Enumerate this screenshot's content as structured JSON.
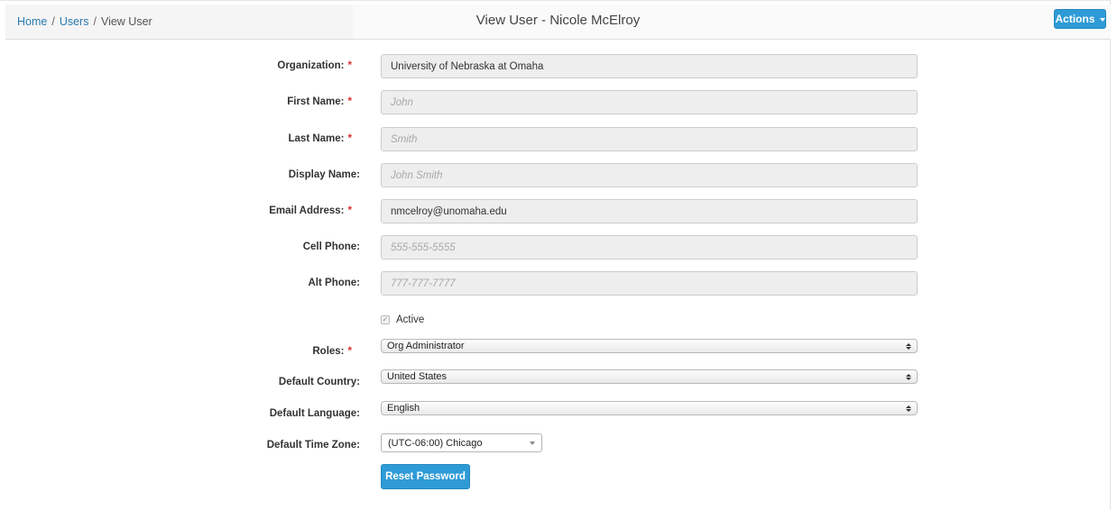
{
  "breadcrumb": {
    "home": "Home",
    "sep1": "/",
    "users": "Users",
    "sep2": "/",
    "current": "View User"
  },
  "page_title": "View User - Nicole McElroy",
  "actions_label": "Actions",
  "required_marker": "*",
  "fields": {
    "organization": {
      "label": "Organization:",
      "value": "University of Nebraska at Omaha"
    },
    "first_name": {
      "label": "First Name:",
      "placeholder": "John"
    },
    "last_name": {
      "label": "Last Name:",
      "placeholder": "Smith"
    },
    "display_name": {
      "label": "Display Name:",
      "placeholder": "John Smith"
    },
    "email": {
      "label": "Email Address:",
      "value": "nmcelroy@unomaha.edu"
    },
    "cell_phone": {
      "label": "Cell Phone:",
      "placeholder": "555-555-5555"
    },
    "alt_phone": {
      "label": "Alt Phone:",
      "placeholder": "777-777-7777"
    }
  },
  "active": {
    "label": "Active",
    "checked": true
  },
  "roles": {
    "label": "Roles:",
    "value": "Org Administrator"
  },
  "default_country": {
    "label": "Default Country:",
    "value": "United States"
  },
  "default_language": {
    "label": "Default Language:",
    "value": "English"
  },
  "default_time_zone": {
    "label": "Default Time Zone:",
    "value": "(UTC-06:00) Chicago"
  },
  "reset_password_label": "Reset Password",
  "colors": {
    "accent": "#2e9bd6",
    "link": "#2a7ab0",
    "required": "#d9302c"
  },
  "icons": {
    "actions_caret": "caret-down-icon",
    "select_arrows": "up-down-arrows-icon",
    "checkbox": "checkmark-icon"
  }
}
